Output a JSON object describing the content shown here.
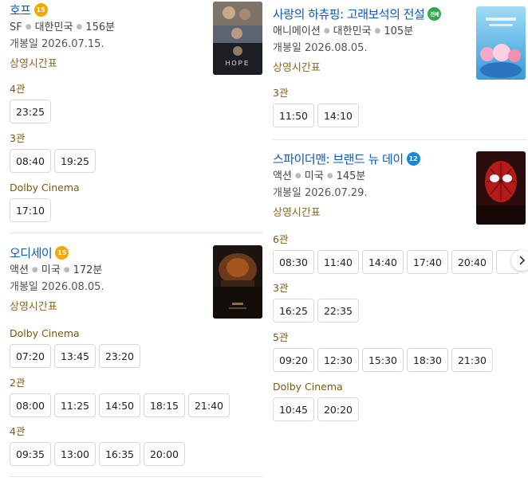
{
  "left_column": {
    "movies": [
      {
        "title": "호프",
        "age_badge": "15",
        "age_badge_color": "#f2a900",
        "genre": "SF",
        "country": "대한민국",
        "runtime": "156분",
        "release": "개봉일 2026.07.15.",
        "schedule_link": "상영시간표",
        "halls": [
          {
            "name": "4관",
            "times": [
              "23:25"
            ]
          },
          {
            "name": "3관",
            "times": [
              "08:40",
              "19:25"
            ]
          },
          {
            "name": "Dolby Cinema",
            "times": [
              "17:10"
            ]
          }
        ]
      },
      {
        "title": "오디세이",
        "age_badge": "15",
        "age_badge_color": "#f2a900",
        "genre": "액션",
        "country": "미국",
        "runtime": "172분",
        "release": "개봉일 2026.08.05.",
        "schedule_link": "상영시간표",
        "halls": [
          {
            "name": "Dolby Cinema",
            "times": [
              "07:20",
              "13:45",
              "23:20"
            ]
          },
          {
            "name": "2관",
            "times": [
              "08:00",
              "11:25",
              "14:50",
              "18:15",
              "21:40"
            ]
          },
          {
            "name": "4관",
            "times": [
              "09:35",
              "13:00",
              "16:35",
              "20:00"
            ]
          }
        ]
      }
    ]
  },
  "right_column": {
    "movies": [
      {
        "title": "사랑의 하츄핑: 고래보석의 전설",
        "age_badge": "전체",
        "age_badge_color": "#2fa84f",
        "genre": "애니메이션",
        "country": "대한민국",
        "runtime": "105분",
        "release": "개봉일 2026.08.05.",
        "schedule_link": "상영시간표",
        "halls": [
          {
            "name": "3관",
            "times": [
              "11:50",
              "14:10"
            ]
          }
        ]
      },
      {
        "title": "스파이더맨: 브랜드 뉴 데이",
        "age_badge": "12",
        "age_badge_color": "#1a86d8",
        "genre": "액션",
        "country": "미국",
        "runtime": "145분",
        "release": "개봉일 2026.07.29.",
        "schedule_link": "상영시간표",
        "halls": [
          {
            "name": "6관",
            "times": [
              "08:30",
              "11:40",
              "14:40",
              "17:40",
              "20:40",
              "2"
            ]
          },
          {
            "name": "3관",
            "times": [
              "16:25",
              "22:35"
            ]
          },
          {
            "name": "5관",
            "times": [
              "09:20",
              "12:30",
              "15:30",
              "18:30",
              "21:30"
            ]
          },
          {
            "name": "Dolby Cinema",
            "times": [
              "10:45",
              "20:20"
            ]
          }
        ]
      }
    ]
  },
  "icons": {
    "scroll_next": "chevron-right-icon"
  }
}
